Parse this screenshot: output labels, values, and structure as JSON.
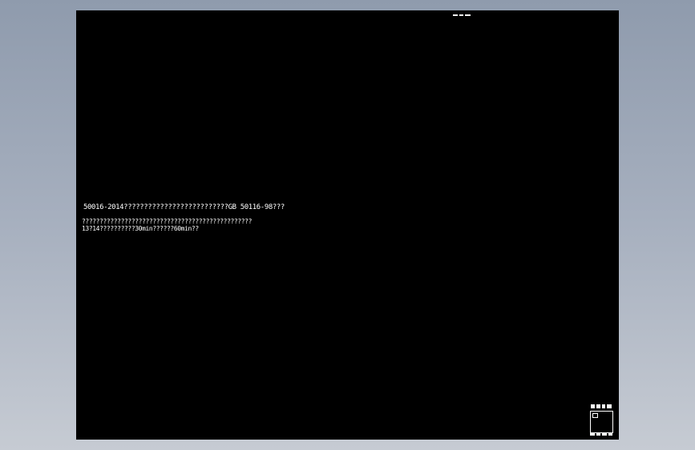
{
  "drawing": {
    "background_color": "#000000",
    "text_color": "#ffffff",
    "notes": [
      "50016-2014??????????????????????????GB 50116-98???",
      "????????????????????????????????????????????????",
      "13?14??????????30min??????60min??"
    ]
  }
}
